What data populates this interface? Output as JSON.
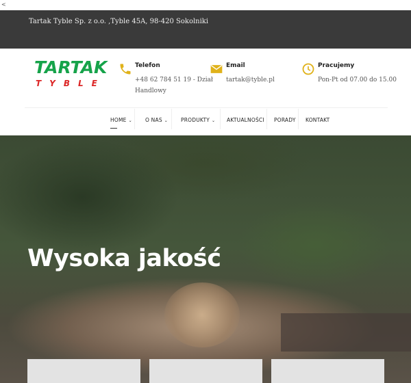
{
  "corner_mark": "<",
  "topbar": {
    "address": "Tartak Tyble Sp. z o.o. ,Tyble 45A, 98-420 Sokolniki"
  },
  "logo": {
    "word": "TARTAK",
    "sub": "TYBLE"
  },
  "contacts": [
    {
      "label": "Telefon",
      "lines": [
        "+48 62 784 51 19 - Dział",
        "Handlowy"
      ],
      "icon": "phone-icon"
    },
    {
      "label": "Email",
      "lines": [
        "tartak@tyble.pl"
      ],
      "icon": "envelope-icon"
    },
    {
      "label": "Pracujemy",
      "lines": [
        "Pon-Pt od 07.00 do 15.00"
      ],
      "icon": "clock-icon"
    }
  ],
  "colors": {
    "accent": "#e0b21a",
    "logo_green": "#16a34a",
    "logo_red": "#dc2626",
    "topbar": "#3a3a3a"
  },
  "nav": {
    "items": [
      {
        "label": "HOME",
        "has_dropdown": true,
        "active": true
      },
      {
        "label": "O NAS",
        "has_dropdown": true
      },
      {
        "label": "PRODUKTY",
        "has_dropdown": true
      },
      {
        "label": "AKTUALNOŚCI",
        "has_dropdown": false
      },
      {
        "label": "PORADY",
        "has_dropdown": false
      },
      {
        "label": "KONTAKT",
        "has_dropdown": false
      }
    ],
    "chevron": "⌄"
  },
  "hero": {
    "title": "Wysoka jakość"
  }
}
